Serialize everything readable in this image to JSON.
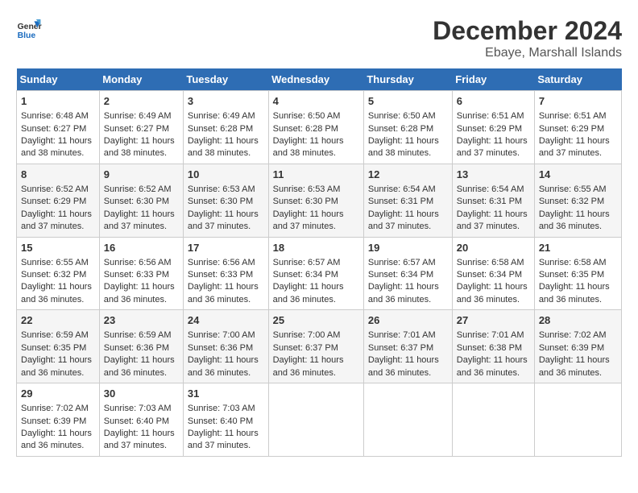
{
  "logo": {
    "line1": "General",
    "line2": "Blue"
  },
  "title": "December 2024",
  "subtitle": "Ebaye, Marshall Islands",
  "days_of_week": [
    "Sunday",
    "Monday",
    "Tuesday",
    "Wednesday",
    "Thursday",
    "Friday",
    "Saturday"
  ],
  "weeks": [
    [
      {
        "day": "1",
        "rise": "6:48 AM",
        "set": "6:27 PM",
        "daylight": "11 hours and 38 minutes."
      },
      {
        "day": "2",
        "rise": "6:49 AM",
        "set": "6:27 PM",
        "daylight": "11 hours and 38 minutes."
      },
      {
        "day": "3",
        "rise": "6:49 AM",
        "set": "6:28 PM",
        "daylight": "11 hours and 38 minutes."
      },
      {
        "day": "4",
        "rise": "6:50 AM",
        "set": "6:28 PM",
        "daylight": "11 hours and 38 minutes."
      },
      {
        "day": "5",
        "rise": "6:50 AM",
        "set": "6:28 PM",
        "daylight": "11 hours and 38 minutes."
      },
      {
        "day": "6",
        "rise": "6:51 AM",
        "set": "6:29 PM",
        "daylight": "11 hours and 37 minutes."
      },
      {
        "day": "7",
        "rise": "6:51 AM",
        "set": "6:29 PM",
        "daylight": "11 hours and 37 minutes."
      }
    ],
    [
      {
        "day": "8",
        "rise": "6:52 AM",
        "set": "6:29 PM",
        "daylight": "11 hours and 37 minutes."
      },
      {
        "day": "9",
        "rise": "6:52 AM",
        "set": "6:30 PM",
        "daylight": "11 hours and 37 minutes."
      },
      {
        "day": "10",
        "rise": "6:53 AM",
        "set": "6:30 PM",
        "daylight": "11 hours and 37 minutes."
      },
      {
        "day": "11",
        "rise": "6:53 AM",
        "set": "6:30 PM",
        "daylight": "11 hours and 37 minutes."
      },
      {
        "day": "12",
        "rise": "6:54 AM",
        "set": "6:31 PM",
        "daylight": "11 hours and 37 minutes."
      },
      {
        "day": "13",
        "rise": "6:54 AM",
        "set": "6:31 PM",
        "daylight": "11 hours and 37 minutes."
      },
      {
        "day": "14",
        "rise": "6:55 AM",
        "set": "6:32 PM",
        "daylight": "11 hours and 36 minutes."
      }
    ],
    [
      {
        "day": "15",
        "rise": "6:55 AM",
        "set": "6:32 PM",
        "daylight": "11 hours and 36 minutes."
      },
      {
        "day": "16",
        "rise": "6:56 AM",
        "set": "6:33 PM",
        "daylight": "11 hours and 36 minutes."
      },
      {
        "day": "17",
        "rise": "6:56 AM",
        "set": "6:33 PM",
        "daylight": "11 hours and 36 minutes."
      },
      {
        "day": "18",
        "rise": "6:57 AM",
        "set": "6:34 PM",
        "daylight": "11 hours and 36 minutes."
      },
      {
        "day": "19",
        "rise": "6:57 AM",
        "set": "6:34 PM",
        "daylight": "11 hours and 36 minutes."
      },
      {
        "day": "20",
        "rise": "6:58 AM",
        "set": "6:34 PM",
        "daylight": "11 hours and 36 minutes."
      },
      {
        "day": "21",
        "rise": "6:58 AM",
        "set": "6:35 PM",
        "daylight": "11 hours and 36 minutes."
      }
    ],
    [
      {
        "day": "22",
        "rise": "6:59 AM",
        "set": "6:35 PM",
        "daylight": "11 hours and 36 minutes."
      },
      {
        "day": "23",
        "rise": "6:59 AM",
        "set": "6:36 PM",
        "daylight": "11 hours and 36 minutes."
      },
      {
        "day": "24",
        "rise": "7:00 AM",
        "set": "6:36 PM",
        "daylight": "11 hours and 36 minutes."
      },
      {
        "day": "25",
        "rise": "7:00 AM",
        "set": "6:37 PM",
        "daylight": "11 hours and 36 minutes."
      },
      {
        "day": "26",
        "rise": "7:01 AM",
        "set": "6:37 PM",
        "daylight": "11 hours and 36 minutes."
      },
      {
        "day": "27",
        "rise": "7:01 AM",
        "set": "6:38 PM",
        "daylight": "11 hours and 36 minutes."
      },
      {
        "day": "28",
        "rise": "7:02 AM",
        "set": "6:39 PM",
        "daylight": "11 hours and 36 minutes."
      }
    ],
    [
      {
        "day": "29",
        "rise": "7:02 AM",
        "set": "6:39 PM",
        "daylight": "11 hours and 36 minutes."
      },
      {
        "day": "30",
        "rise": "7:03 AM",
        "set": "6:40 PM",
        "daylight": "11 hours and 37 minutes."
      },
      {
        "day": "31",
        "rise": "7:03 AM",
        "set": "6:40 PM",
        "daylight": "11 hours and 37 minutes."
      },
      null,
      null,
      null,
      null
    ]
  ],
  "labels": {
    "sunrise": "Sunrise:",
    "sunset": "Sunset:",
    "daylight": "Daylight:"
  }
}
